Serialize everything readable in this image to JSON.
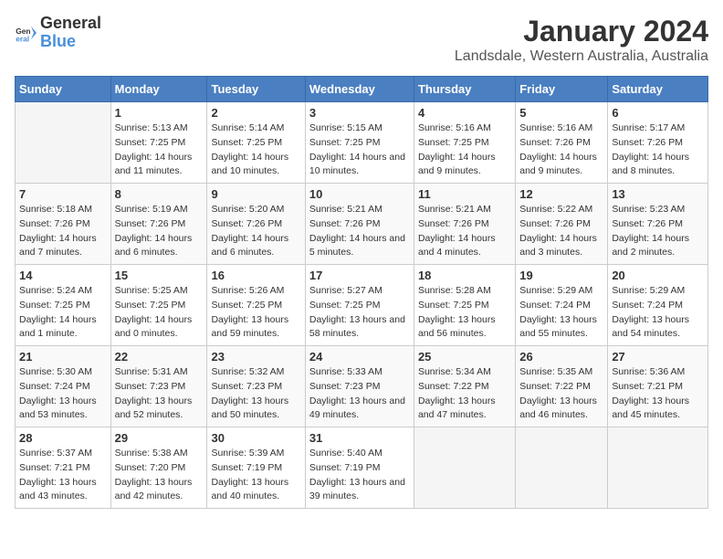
{
  "logo": {
    "general": "General",
    "blue": "Blue"
  },
  "title": "January 2024",
  "subtitle": "Landsdale, Western Australia, Australia",
  "headers": [
    "Sunday",
    "Monday",
    "Tuesday",
    "Wednesday",
    "Thursday",
    "Friday",
    "Saturday"
  ],
  "weeks": [
    [
      {
        "day": "",
        "sunrise": "",
        "sunset": "",
        "daylight": ""
      },
      {
        "day": "1",
        "sunrise": "5:13 AM",
        "sunset": "7:25 PM",
        "daylight": "14 hours and 11 minutes."
      },
      {
        "day": "2",
        "sunrise": "5:14 AM",
        "sunset": "7:25 PM",
        "daylight": "14 hours and 10 minutes."
      },
      {
        "day": "3",
        "sunrise": "5:15 AM",
        "sunset": "7:25 PM",
        "daylight": "14 hours and 10 minutes."
      },
      {
        "day": "4",
        "sunrise": "5:16 AM",
        "sunset": "7:25 PM",
        "daylight": "14 hours and 9 minutes."
      },
      {
        "day": "5",
        "sunrise": "5:16 AM",
        "sunset": "7:26 PM",
        "daylight": "14 hours and 9 minutes."
      },
      {
        "day": "6",
        "sunrise": "5:17 AM",
        "sunset": "7:26 PM",
        "daylight": "14 hours and 8 minutes."
      }
    ],
    [
      {
        "day": "7",
        "sunrise": "5:18 AM",
        "sunset": "7:26 PM",
        "daylight": "14 hours and 7 minutes."
      },
      {
        "day": "8",
        "sunrise": "5:19 AM",
        "sunset": "7:26 PM",
        "daylight": "14 hours and 6 minutes."
      },
      {
        "day": "9",
        "sunrise": "5:20 AM",
        "sunset": "7:26 PM",
        "daylight": "14 hours and 6 minutes."
      },
      {
        "day": "10",
        "sunrise": "5:21 AM",
        "sunset": "7:26 PM",
        "daylight": "14 hours and 5 minutes."
      },
      {
        "day": "11",
        "sunrise": "5:21 AM",
        "sunset": "7:26 PM",
        "daylight": "14 hours and 4 minutes."
      },
      {
        "day": "12",
        "sunrise": "5:22 AM",
        "sunset": "7:26 PM",
        "daylight": "14 hours and 3 minutes."
      },
      {
        "day": "13",
        "sunrise": "5:23 AM",
        "sunset": "7:26 PM",
        "daylight": "14 hours and 2 minutes."
      }
    ],
    [
      {
        "day": "14",
        "sunrise": "5:24 AM",
        "sunset": "7:25 PM",
        "daylight": "14 hours and 1 minute."
      },
      {
        "day": "15",
        "sunrise": "5:25 AM",
        "sunset": "7:25 PM",
        "daylight": "14 hours and 0 minutes."
      },
      {
        "day": "16",
        "sunrise": "5:26 AM",
        "sunset": "7:25 PM",
        "daylight": "13 hours and 59 minutes."
      },
      {
        "day": "17",
        "sunrise": "5:27 AM",
        "sunset": "7:25 PM",
        "daylight": "13 hours and 58 minutes."
      },
      {
        "day": "18",
        "sunrise": "5:28 AM",
        "sunset": "7:25 PM",
        "daylight": "13 hours and 56 minutes."
      },
      {
        "day": "19",
        "sunrise": "5:29 AM",
        "sunset": "7:24 PM",
        "daylight": "13 hours and 55 minutes."
      },
      {
        "day": "20",
        "sunrise": "5:29 AM",
        "sunset": "7:24 PM",
        "daylight": "13 hours and 54 minutes."
      }
    ],
    [
      {
        "day": "21",
        "sunrise": "5:30 AM",
        "sunset": "7:24 PM",
        "daylight": "13 hours and 53 minutes."
      },
      {
        "day": "22",
        "sunrise": "5:31 AM",
        "sunset": "7:23 PM",
        "daylight": "13 hours and 52 minutes."
      },
      {
        "day": "23",
        "sunrise": "5:32 AM",
        "sunset": "7:23 PM",
        "daylight": "13 hours and 50 minutes."
      },
      {
        "day": "24",
        "sunrise": "5:33 AM",
        "sunset": "7:23 PM",
        "daylight": "13 hours and 49 minutes."
      },
      {
        "day": "25",
        "sunrise": "5:34 AM",
        "sunset": "7:22 PM",
        "daylight": "13 hours and 47 minutes."
      },
      {
        "day": "26",
        "sunrise": "5:35 AM",
        "sunset": "7:22 PM",
        "daylight": "13 hours and 46 minutes."
      },
      {
        "day": "27",
        "sunrise": "5:36 AM",
        "sunset": "7:21 PM",
        "daylight": "13 hours and 45 minutes."
      }
    ],
    [
      {
        "day": "28",
        "sunrise": "5:37 AM",
        "sunset": "7:21 PM",
        "daylight": "13 hours and 43 minutes."
      },
      {
        "day": "29",
        "sunrise": "5:38 AM",
        "sunset": "7:20 PM",
        "daylight": "13 hours and 42 minutes."
      },
      {
        "day": "30",
        "sunrise": "5:39 AM",
        "sunset": "7:19 PM",
        "daylight": "13 hours and 40 minutes."
      },
      {
        "day": "31",
        "sunrise": "5:40 AM",
        "sunset": "7:19 PM",
        "daylight": "13 hours and 39 minutes."
      },
      {
        "day": "",
        "sunrise": "",
        "sunset": "",
        "daylight": ""
      },
      {
        "day": "",
        "sunrise": "",
        "sunset": "",
        "daylight": ""
      },
      {
        "day": "",
        "sunrise": "",
        "sunset": "",
        "daylight": ""
      }
    ]
  ]
}
